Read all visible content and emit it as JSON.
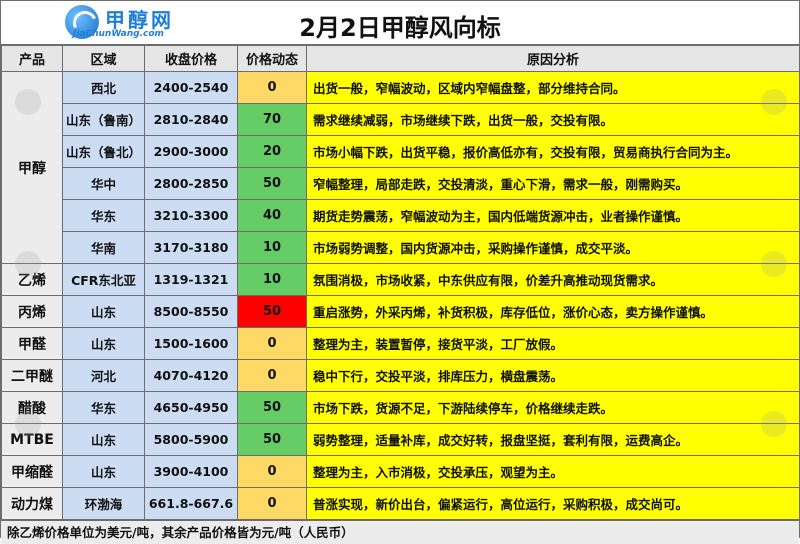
{
  "logo": {
    "text": "甲醇网",
    "url": "JiaChunWang.com"
  },
  "title": "2月2日甲醇风向标",
  "headers": {
    "product": "产品",
    "region": "区域",
    "price": "收盘价格",
    "signal": "价格动态",
    "reason": "原因分析"
  },
  "colors": {
    "signal_green": "#66cc66",
    "signal_yellow": "#ffd966",
    "signal_red": "#ff0000",
    "region_blue": "#ccdcf3",
    "reason_yellow": "#ffff00"
  },
  "rows": [
    {
      "product": "甲醇",
      "region": "西北",
      "price": "2400-2540",
      "signal": "0",
      "level": "yellow",
      "reason": "出货一般，窄幅波动，区域内窄幅盘整，部分维持合同。"
    },
    {
      "product": "",
      "region": "山东（鲁南）",
      "price": "2810-2840",
      "signal": "70",
      "level": "green",
      "reason": "需求继续减弱，市场继续下跌，出货一般，交投有限。"
    },
    {
      "product": "",
      "region": "山东（鲁北）",
      "price": "2900-3000",
      "signal": "20",
      "level": "green",
      "reason": "市场小幅下跌，出货平稳，报价高低亦有，交投有限，贸易商执行合同为主。"
    },
    {
      "product": "",
      "region": "华中",
      "price": "2800-2850",
      "signal": "50",
      "level": "green",
      "reason": "窄幅整理，局部走跌，交投清淡，重心下滑，需求一般，刚需购买。"
    },
    {
      "product": "",
      "region": "华东",
      "price": "3210-3300",
      "signal": "40",
      "level": "green",
      "reason": "期货走势震荡，窄幅波动为主，国内低端货源冲击，业者操作谨慎。"
    },
    {
      "product": "",
      "region": "华南",
      "price": "3170-3180",
      "signal": "10",
      "level": "green",
      "reason": "市场弱势调整，国内货源冲击，采购操作谨慎，成交平淡。"
    },
    {
      "product": "乙烯",
      "region": "CFR东北亚",
      "price": "1319-1321",
      "signal": "10",
      "level": "green",
      "reason": "氛围消极，市场收紧，中东供应有限，价差升高推动现货需求。"
    },
    {
      "product": "丙烯",
      "region": "山东",
      "price": "8500-8550",
      "signal": "50",
      "level": "red",
      "reason": "重启涨势，外采丙烯，补货积极，库存低位，涨价心态，卖方操作谨慎。"
    },
    {
      "product": "甲醛",
      "region": "山东",
      "price": "1500-1600",
      "signal": "0",
      "level": "yellow",
      "reason": "整理为主，装置暂停，接货平淡，工厂放假。"
    },
    {
      "product": "二甲醚",
      "region": "河北",
      "price": "4070-4120",
      "signal": "0",
      "level": "yellow",
      "reason": "稳中下行，交投平淡，排库压力，横盘震荡。"
    },
    {
      "product": "醋酸",
      "region": "华东",
      "price": "4650-4950",
      "signal": "50",
      "level": "green",
      "reason": "市场下跌，货源不足，下游陆续停车，价格继续走跌。"
    },
    {
      "product": "MTBE",
      "region": "山东",
      "price": "5800-5900",
      "signal": "50",
      "level": "green",
      "reason": "弱势整理，适量补库，成交好转，报盘坚挺，套利有限，运费高企。"
    },
    {
      "product": "甲缩醛",
      "region": "山东",
      "price": "3900-4100",
      "signal": "0",
      "level": "yellow",
      "reason": "整理为主，入市消极，交投承压，观望为主。"
    },
    {
      "product": "动力煤",
      "region": "环渤海",
      "price": "661.8-667.6",
      "signal": "0",
      "level": "yellow",
      "reason": "普涨实现，新价出台，偏紧运行，高位运行，采购积极，成交尚可。"
    }
  ],
  "footer": "除乙烯价格单位为美元/吨，其余产品价格皆为元/吨（人民币）"
}
